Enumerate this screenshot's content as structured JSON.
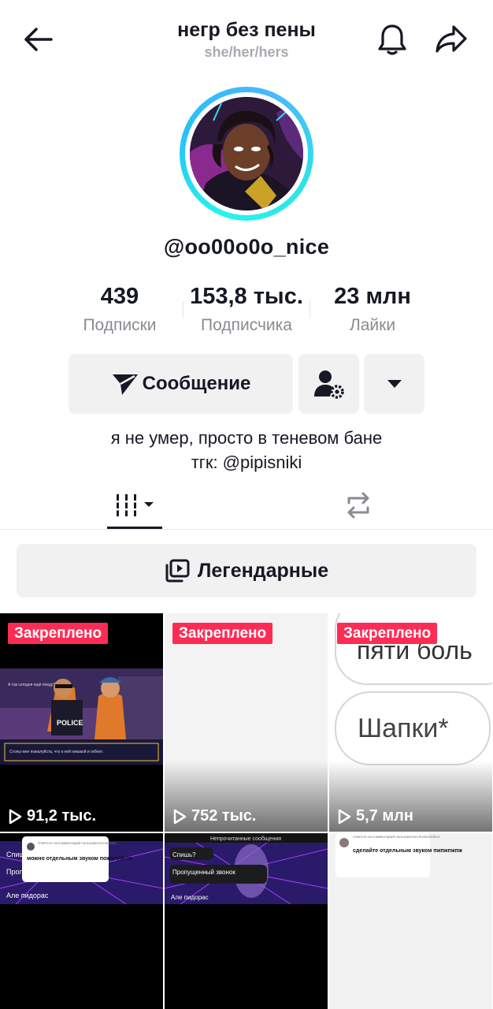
{
  "header": {
    "title": "негр без пены",
    "pronouns": "she/her/hers"
  },
  "profile": {
    "username": "@oo00o0o_nice",
    "bio_line1": "я не умер, просто в теневом бане",
    "bio_line2": "тгк: @pipisniki"
  },
  "stats": [
    {
      "value": "439",
      "label": "Подписки"
    },
    {
      "value": "153,8 тыс.",
      "label": "Подписчика"
    },
    {
      "value": "23 млн",
      "label": "Лайки"
    }
  ],
  "actions": {
    "message_label": "Сообщение"
  },
  "playlist": {
    "label": "Легендарные"
  },
  "videos": [
    {
      "pinned_label": "Закреплено",
      "views": "91,2 тыс.",
      "dialog_line": "Стопы мне пожалуйста, что к ней никакой и гибнет.",
      "dialog_top": "А так сегодня ещё поеду?"
    },
    {
      "pinned_label": "Закреплено",
      "views": "752 тыс."
    },
    {
      "pinned_label": "Закреплено",
      "views": "5,7 млн",
      "text_top": "пяти боль",
      "text_word": "Шапки*"
    },
    {
      "comment_header": "Ответьте на комментарий пользователя ваниль",
      "comment_text": "можно отдельным звуком пожалуйста",
      "chat_1": "Спиш",
      "chat_2": "Пропу",
      "chat_3": "Але пидорас"
    },
    {
      "chat_title": "Непрочитанные сообщения",
      "chat_1": "Спишь?",
      "chat_2": "Пропущенный звонок",
      "chat_3": "Але пидорас"
    },
    {
      "comment_header": "ответьте на комментарий пользователя levslumeles4",
      "comment_text": "сделайте отдельным звуком пжпжпжпж"
    }
  ],
  "colors": {
    "accent": "#fe2c55",
    "ring": "#25f4ee"
  }
}
